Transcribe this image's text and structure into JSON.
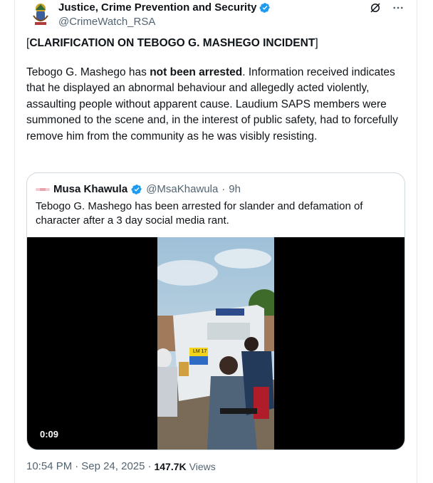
{
  "author": {
    "name": "Justice, Crime Prevention and Security",
    "handle": "@CrimeWatch_RSA"
  },
  "tweet": {
    "heading_open": "[",
    "heading_bold": "CLARIFICATION ON TEBOGO G. MASHEGO INCIDENT",
    "heading_close": "]",
    "body_pre": "Tebogo G. Mashego has ",
    "body_bold": "not been arrested",
    "body_post": ". Information received indicates that he displayed an abnormal behaviour and allegedly acted violently, assaulting people without apparent cause. Laudium SAPS members were summoned to the scene and, in the interest of public safety, had to forcefully remove him from the community as he was visibly resisting."
  },
  "quoted": {
    "name": "Musa Khawula",
    "handle": "@MsaKhawula",
    "separator": "·",
    "time": "9h",
    "text": "Tebogo G. Mashego has been arrested for slander and defamation of character after a 3 day social media rant.",
    "video_duration": "0:09",
    "vehicle_label": "LM 17"
  },
  "footer": {
    "time": "10:54 PM",
    "dot": "·",
    "date": "Sep 24, 2025",
    "dot2": "·",
    "views_count": "147.7K",
    "views_label": "Views"
  },
  "colors": {
    "verified": "#1d9bf0",
    "muted": "#536471",
    "text": "#0f1419",
    "border": "#cfd9de"
  },
  "icons": {
    "grok": "grok-icon",
    "more": "more-icon",
    "verified": "verified-badge-icon"
  }
}
